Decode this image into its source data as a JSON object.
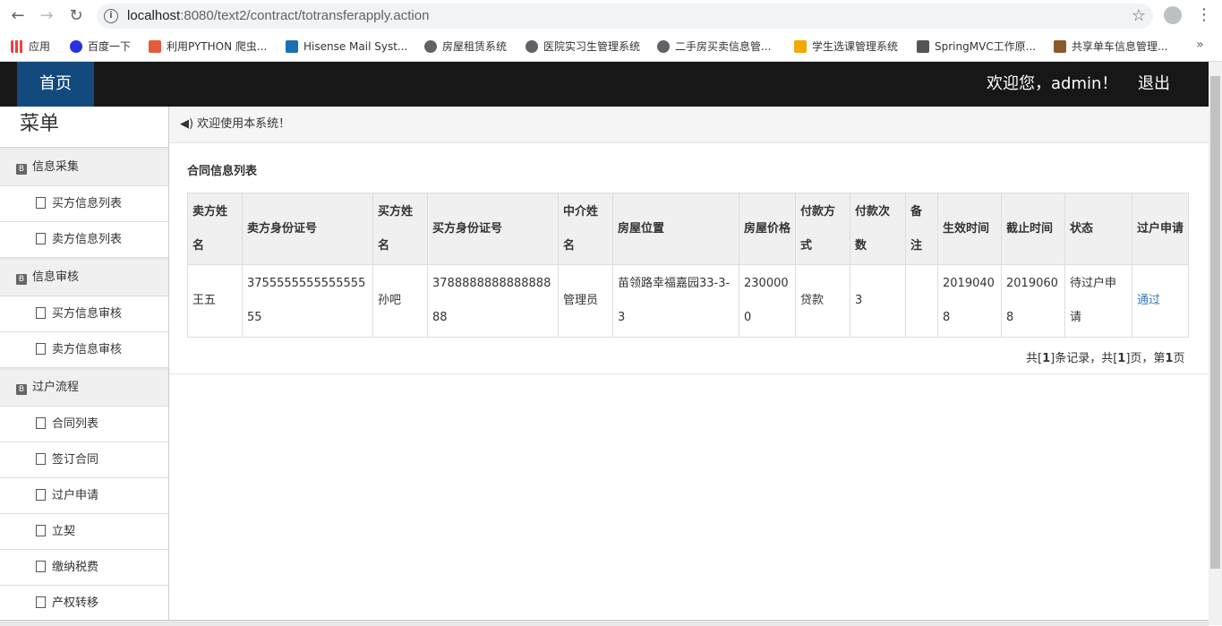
{
  "browser": {
    "url_host": "localhost",
    "url_rest": ":8080/text2/contract/totransferapply.action",
    "bookmarks": [
      {
        "label": "应用",
        "color": "#e8453c"
      },
      {
        "label": "百度一下",
        "color": "#2932e1"
      },
      {
        "label": "利用PYTHON 爬虫...",
        "color": "#e45a3c"
      },
      {
        "label": "Hisense Mail Syst...",
        "color": "#1a6fb5"
      },
      {
        "label": "房屋租赁系统",
        "color": "#5f6368"
      },
      {
        "label": "医院实习生管理系统",
        "color": "#5f6368"
      },
      {
        "label": "二手房买卖信息管...",
        "color": "#5f6368"
      },
      {
        "label": "学生选课管理系统",
        "color": "#f2a900"
      },
      {
        "label": "SpringMVC工作原...",
        "color": "#555555"
      },
      {
        "label": "共享单车信息管理...",
        "color": "#8a5a2b"
      }
    ],
    "more": "»"
  },
  "header": {
    "home_label": "首页",
    "welcome": "欢迎您，admin！",
    "logout": "退出"
  },
  "sidebar": {
    "title": "菜单",
    "groups": [
      {
        "label": "信息采集",
        "items": [
          "买方信息列表",
          "卖方信息列表"
        ]
      },
      {
        "label": "信息审核",
        "items": [
          "买方信息审核",
          "卖方信息审核"
        ]
      },
      {
        "label": "过户流程",
        "items": [
          "合同列表",
          "签订合同",
          "过户申请",
          "立契",
          "缴纳税费",
          "产权转移"
        ]
      }
    ]
  },
  "notice": "欢迎使用本系统！",
  "list": {
    "title": "合同信息列表",
    "columns": [
      "卖方姓名",
      "卖方身份证号",
      "买方姓名",
      "买方身份证号",
      "中介姓名",
      "房屋位置",
      "房屋价格",
      "付款方式",
      "付款次数",
      "备注",
      "生效时间",
      "截止时间",
      "状态",
      "过户申请"
    ],
    "rows": [
      [
        "王五",
        "375555555555555555",
        "孙吧",
        "378888888888888888",
        "管理员",
        "苗领路幸福嘉园33-3-3",
        "2300000",
        "贷款",
        "3",
        "",
        "20190408",
        "20190608",
        "待过户申请",
        "通过"
      ]
    ]
  },
  "pager": {
    "p1": "共[",
    "total": "1",
    "p2": "]条记录，共[",
    "pages": "1",
    "p3": "]页，第",
    "current": "1",
    "p4": "页"
  }
}
